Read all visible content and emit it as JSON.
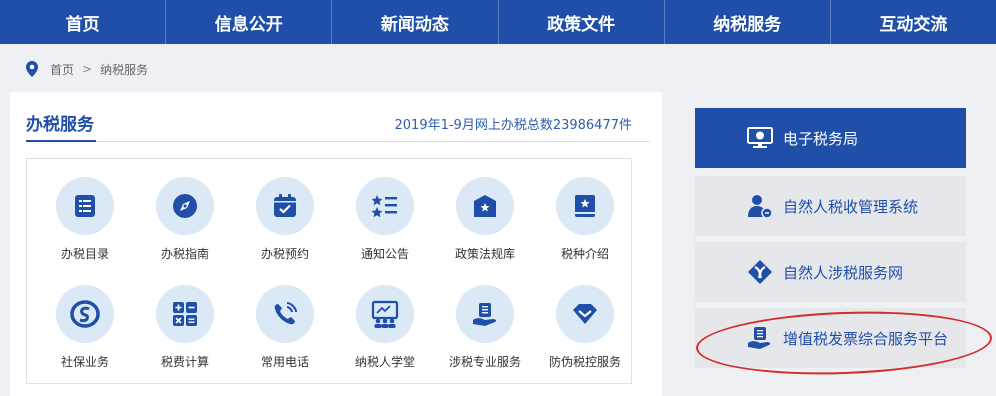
{
  "nav": {
    "items": [
      {
        "label": "首页"
      },
      {
        "label": "信息公开"
      },
      {
        "label": "新闻动态"
      },
      {
        "label": "政策文件"
      },
      {
        "label": "纳税服务"
      },
      {
        "label": "互动交流"
      }
    ]
  },
  "breadcrumb": {
    "home": "首页",
    "separator": ">",
    "current": "纳税服务"
  },
  "main": {
    "title": "办税服务",
    "stat": "2019年1-9月网上办税总数23986477件",
    "services": [
      {
        "label": "办税目录",
        "icon": "list-icon"
      },
      {
        "label": "办税指南",
        "icon": "compass-icon"
      },
      {
        "label": "办税预约",
        "icon": "calendar-check-icon"
      },
      {
        "label": "通知公告",
        "icon": "notice-list-icon"
      },
      {
        "label": "政策法规库",
        "icon": "law-library-icon"
      },
      {
        "label": "税种介绍",
        "icon": "book-icon"
      },
      {
        "label": "社保业务",
        "icon": "social-security-icon"
      },
      {
        "label": "税费计算",
        "icon": "calculator-icon"
      },
      {
        "label": "常用电话",
        "icon": "phone-icon"
      },
      {
        "label": "纳税人学堂",
        "icon": "classroom-icon"
      },
      {
        "label": "涉税专业服务",
        "icon": "professional-service-icon"
      },
      {
        "label": "防伪税控服务",
        "icon": "diamond-icon"
      }
    ]
  },
  "sidebar": {
    "items": [
      {
        "label": "电子税务局",
        "icon": "monitor-icon"
      },
      {
        "label": "自然人税收管理系统",
        "icon": "person-tax-icon"
      },
      {
        "label": "自然人涉税服务网",
        "icon": "service-network-icon"
      },
      {
        "label": "增值税发票综合服务平台",
        "icon": "invoice-platform-icon"
      }
    ]
  },
  "colors": {
    "brand_blue": "#1f4fa8",
    "icon_circle": "#dbe8f5",
    "highlight_ellipse": "#d42b2b"
  }
}
